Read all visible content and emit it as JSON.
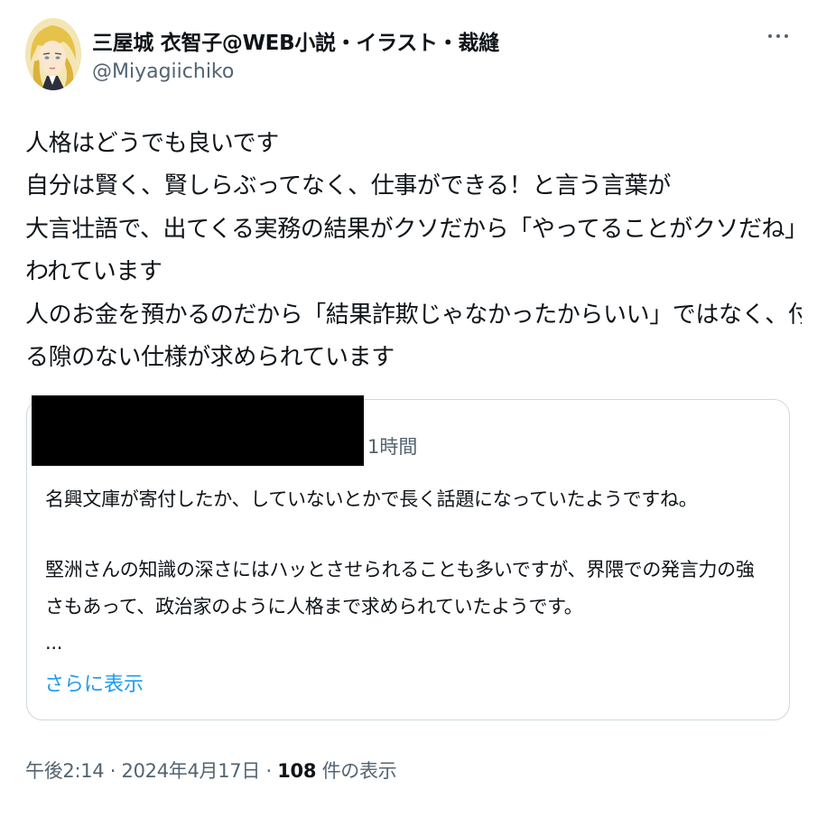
{
  "author": {
    "display_name": "三屋城 衣智子@WEB小説・イラスト・裁縫",
    "handle": "@Miyagiichiko",
    "avatar_icon": "illustrated-portrait-avatar"
  },
  "more_icon": "more-horizontal-icon",
  "tweet_lines": [
    "人格はどうでも良いです",
    "自分は賢く、賢しらぶってなく、仕事ができる！と言う言葉が",
    "大言壮語で、出てくる実務の結果がクソだから「やってることがクソだね」と言",
    "われています",
    "人のお金を預かるのだから「結果詐欺じゃなかったからいい」ではなく、付け入",
    "る隙のない仕様が求められています"
  ],
  "quoted_tweet": {
    "time": "1時間",
    "lines": [
      "名興文庫が寄付したか、していないとかで長く話題になっていたようですね。",
      "",
      "堅洲さんの知識の深さにはハッとさせられることも多いですが、界隈での発言力の強",
      "さもあって、政治家のように人格まで求められていたようです。",
      "..."
    ],
    "show_more": "さらに表示"
  },
  "meta": {
    "time": "午後2:14",
    "separator": "·",
    "date": "2024年4月17日",
    "views_count": "108",
    "views_label": "件の表示"
  },
  "colors": {
    "text": "#0f1419",
    "secondary": "#536471",
    "link": "#1d9bf0",
    "border": "#cfd9de"
  }
}
